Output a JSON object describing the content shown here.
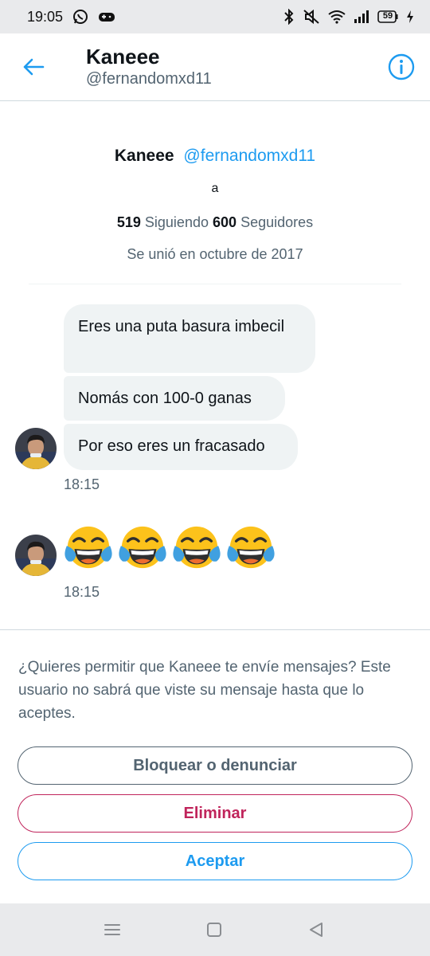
{
  "status_bar": {
    "time": "19:05",
    "battery": "59"
  },
  "header": {
    "title": "Kaneee",
    "handle": "@fernandomxd11"
  },
  "profile": {
    "name": "Kaneee",
    "handle": "@fernandomxd11",
    "bio": "a",
    "following_count": "519",
    "following_label": "Siguiendo",
    "followers_count": "600",
    "followers_label": "Seguidores",
    "joined": "Se unió en octubre de 2017"
  },
  "messages": [
    {
      "text": "Eres una puta basura imbecil"
    },
    {
      "text": "Nomás con 100-0 ganas"
    },
    {
      "text": "Por eso eres un fracasado"
    }
  ],
  "message_groups": [
    {
      "time": "18:15"
    },
    {
      "time": "18:15",
      "emojis": [
        "😂",
        "😂",
        "😂",
        "😂"
      ]
    }
  ],
  "request": {
    "text": "¿Quieres permitir que Kaneee te envíe mensajes? Este usuario no sabrá que viste su mensaje hasta que lo aceptes.",
    "block_label": "Bloquear o denunciar",
    "delete_label": "Eliminar",
    "accept_label": "Aceptar"
  },
  "colors": {
    "accent": "#1d9bf0",
    "danger": "#c0245b",
    "muted": "#536471",
    "bubble": "#eff3f4"
  }
}
